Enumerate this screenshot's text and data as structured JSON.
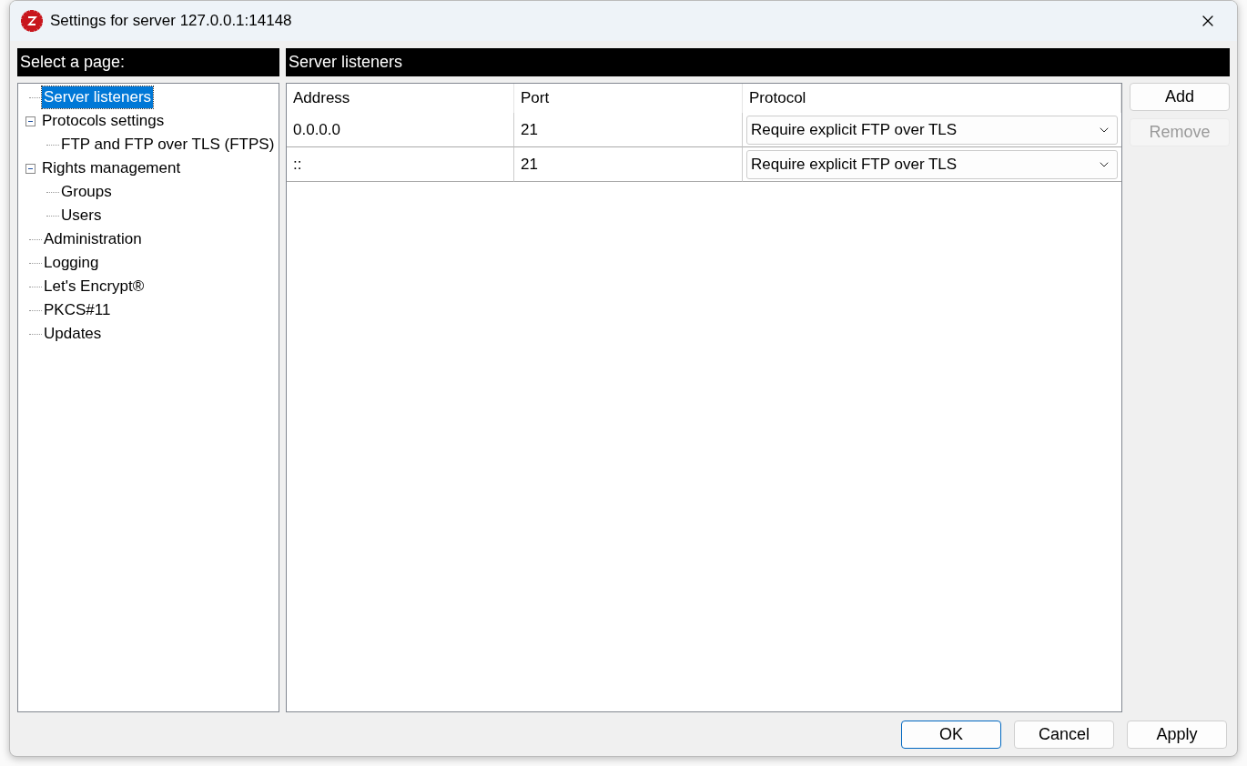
{
  "window": {
    "title": "Settings for server 127.0.0.1:14148"
  },
  "sidebar": {
    "header": "Select a page:",
    "items": [
      {
        "label": "Server listeners",
        "selected": true
      },
      {
        "label": "Protocols settings",
        "selected": false,
        "expanded": true,
        "children": [
          {
            "label": "FTP and FTP over TLS (FTPS)",
            "selected": false
          }
        ]
      },
      {
        "label": "Rights management",
        "selected": false,
        "expanded": true,
        "children": [
          {
            "label": "Groups",
            "selected": false
          },
          {
            "label": "Users",
            "selected": false
          }
        ]
      },
      {
        "label": "Administration",
        "selected": false
      },
      {
        "label": "Logging",
        "selected": false
      },
      {
        "label": "Let's Encrypt®",
        "selected": false
      },
      {
        "label": "PKCS#11",
        "selected": false
      },
      {
        "label": "Updates",
        "selected": false
      }
    ]
  },
  "page": {
    "header": "Server listeners",
    "table": {
      "columns": [
        "Address",
        "Port",
        "Protocol"
      ],
      "rows": [
        {
          "address": "0.0.0.0",
          "port": "21",
          "protocol": "Require explicit FTP over TLS"
        },
        {
          "address": "::",
          "port": "21",
          "protocol": "Require explicit FTP over TLS"
        }
      ]
    },
    "side_buttons": [
      {
        "label": "Add",
        "disabled": false
      },
      {
        "label": "Remove",
        "disabled": true
      }
    ]
  },
  "buttons": [
    {
      "label": "OK",
      "default": true
    },
    {
      "label": "Cancel",
      "default": false
    },
    {
      "label": "Apply",
      "default": false
    }
  ]
}
